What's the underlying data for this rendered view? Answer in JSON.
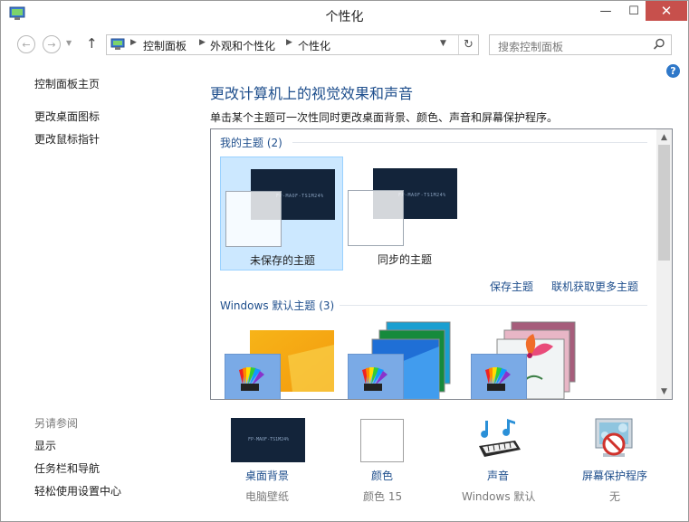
{
  "window": {
    "title": "个性化"
  },
  "titlebar_buttons": {
    "minimize": "—",
    "maximize": "☐",
    "close": "✕"
  },
  "nav": {
    "back": "←",
    "forward": "→",
    "up": "↑",
    "refresh": "↻"
  },
  "breadcrumb": [
    "控制面板",
    "外观和个性化",
    "个性化"
  ],
  "search": {
    "placeholder": "搜索控制面板"
  },
  "sidebar": {
    "home": "控制面板主页",
    "links": [
      "更改桌面图标",
      "更改鼠标指针"
    ],
    "see_also_label": "另请参阅",
    "see_also": [
      "显示",
      "任务栏和导航",
      "轻松使用设置中心"
    ]
  },
  "main": {
    "title": "更改计算机上的视觉效果和声音",
    "description": "单击某个主题可一次性同时更改桌面背景、颜色、声音和屏幕保护程序。"
  },
  "themes": {
    "my_section": "我的主题 (2)",
    "my_themes": [
      {
        "label": "未保存的主题",
        "selected": true
      },
      {
        "label": "同步的主题",
        "selected": false
      }
    ],
    "thumb_text": "FP-MAOF-TS1M24%",
    "save_link": "保存主题",
    "online_link": "联机获取更多主题",
    "default_section": "Windows 默认主题 (3)"
  },
  "bottom": [
    {
      "label": "桌面背景",
      "sub": "电脑壁纸",
      "icon": "desktop-background-icon"
    },
    {
      "label": "颜色",
      "sub": "颜色 15",
      "icon": "color-icon"
    },
    {
      "label": "声音",
      "sub": "Windows 默认",
      "icon": "sound-icon"
    },
    {
      "label": "屏幕保护程序",
      "sub": "无",
      "icon": "screensaver-icon"
    }
  ],
  "colors": {
    "link": "#1e4e8c",
    "selection": "#cce8ff",
    "close_button": "#c7504c",
    "help": "#2f78c9"
  }
}
